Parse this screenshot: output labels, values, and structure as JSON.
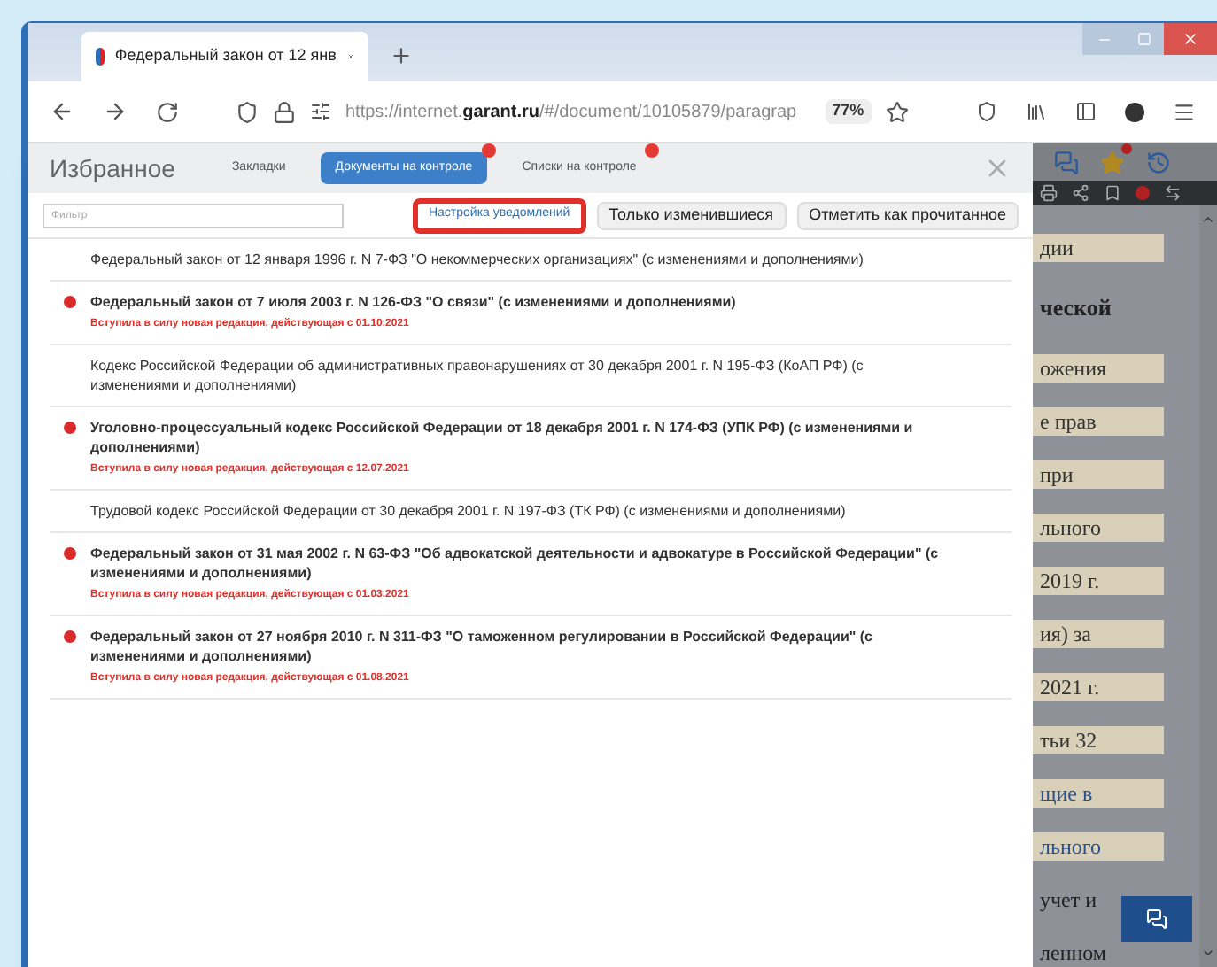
{
  "browser": {
    "tab": {
      "title": "Федеральный закон от 12 янв"
    },
    "url": "https://internet.**garant.ru**/#/document/10105879/paragrap",
    "zoom": "77%"
  },
  "panel": {
    "title": "Избранное",
    "tabs": [
      {
        "label": "Закладки",
        "selected": false,
        "badge": false
      },
      {
        "label": "Документы на контроле",
        "selected": true,
        "badge": true
      },
      {
        "label": "Списки на контроле",
        "selected": false,
        "badge": true
      }
    ],
    "filter": {
      "placeholder": "Фильтр"
    },
    "buttons": [
      {
        "label": "Настройка уведомлений",
        "highlighted": true
      },
      {
        "label": "Только изменившиеся",
        "highlighted": false
      },
      {
        "label": "Отметить как прочитанное",
        "highlighted": false
      }
    ],
    "documents": [
      {
        "title": "Федеральный закон от 12 января 1996 г. N 7-ФЗ \"О некоммерческих организациях\" (с изменениями и дополнениями)",
        "changed": false
      },
      {
        "title": "Федеральный закон от 7 июля 2003 г. N 126-ФЗ \"О связи\" (с изменениями и дополнениями)",
        "changed": true,
        "note": "Вступила в силу новая редакция, действующая с 01.10.2021"
      },
      {
        "title": "Кодекс Российской Федерации об административных правонарушениях от 30 декабря 2001 г. N 195-ФЗ (КоАП РФ) (с изменениями и дополнениями)",
        "changed": false
      },
      {
        "title": "Уголовно-процессуальный кодекс Российской Федерации от 18 декабря 2001 г. N 174-ФЗ (УПК РФ) (с изменениями и дополнениями)",
        "changed": true,
        "note": "Вступила в силу новая редакция, действующая с 12.07.2021"
      },
      {
        "title": "Трудовой кодекс Российской Федерации от 30 декабря 2001 г. N 197-ФЗ (ТК РФ) (с изменениями и дополнениями)",
        "changed": false
      },
      {
        "title": "Федеральный закон от 31 мая 2002 г. N 63-ФЗ \"Об адвокатской деятельности и адвокатуре в Российской Федерации\" (с изменениями и дополнениями)",
        "changed": true,
        "note": "Вступила в силу новая редакция, действующая с 01.03.2021"
      },
      {
        "title": "Федеральный закон от 27 ноября 2010 г. N 311-ФЗ \"О таможенном регулировании в Российской Федерации\" (с изменениями и дополнениями)",
        "changed": true,
        "note": "Вступила в силу новая редакция, действующая с 01.08.2021"
      }
    ]
  },
  "background_document": {
    "fragments": [
      {
        "text": "дии",
        "kind": "shaded"
      },
      {
        "text": "ческой",
        "kind": "heading"
      },
      {
        "text": "ожения",
        "kind": "shaded"
      },
      {
        "text": "е прав",
        "kind": "shaded"
      },
      {
        "text": "при",
        "kind": "shaded"
      },
      {
        "text": "льного",
        "kind": "shaded"
      },
      {
        "text": "2019 г.",
        "kind": "shaded"
      },
      {
        "text": "ия) за",
        "kind": "shaded"
      },
      {
        "text": "2021 г.",
        "kind": "shaded"
      },
      {
        "text": "тьи 32",
        "kind": "shaded"
      },
      {
        "text": "щие в",
        "kind": "link"
      },
      {
        "text": "льного",
        "kind": "link"
      },
      {
        "text": "учет и",
        "kind": "plain"
      },
      {
        "text": "ленном",
        "kind": "plain"
      }
    ]
  }
}
